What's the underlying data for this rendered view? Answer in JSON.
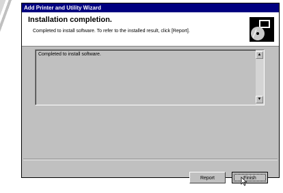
{
  "window": {
    "title": "Add Printer and Utility Wizard"
  },
  "header": {
    "title": "Installation completion.",
    "subtitle": "Completed to install software. To refer to the installed result, click [Report]."
  },
  "result_box": {
    "text": "Completed to install software."
  },
  "buttons": {
    "report_label": "Report",
    "finish_label": "Finish"
  }
}
